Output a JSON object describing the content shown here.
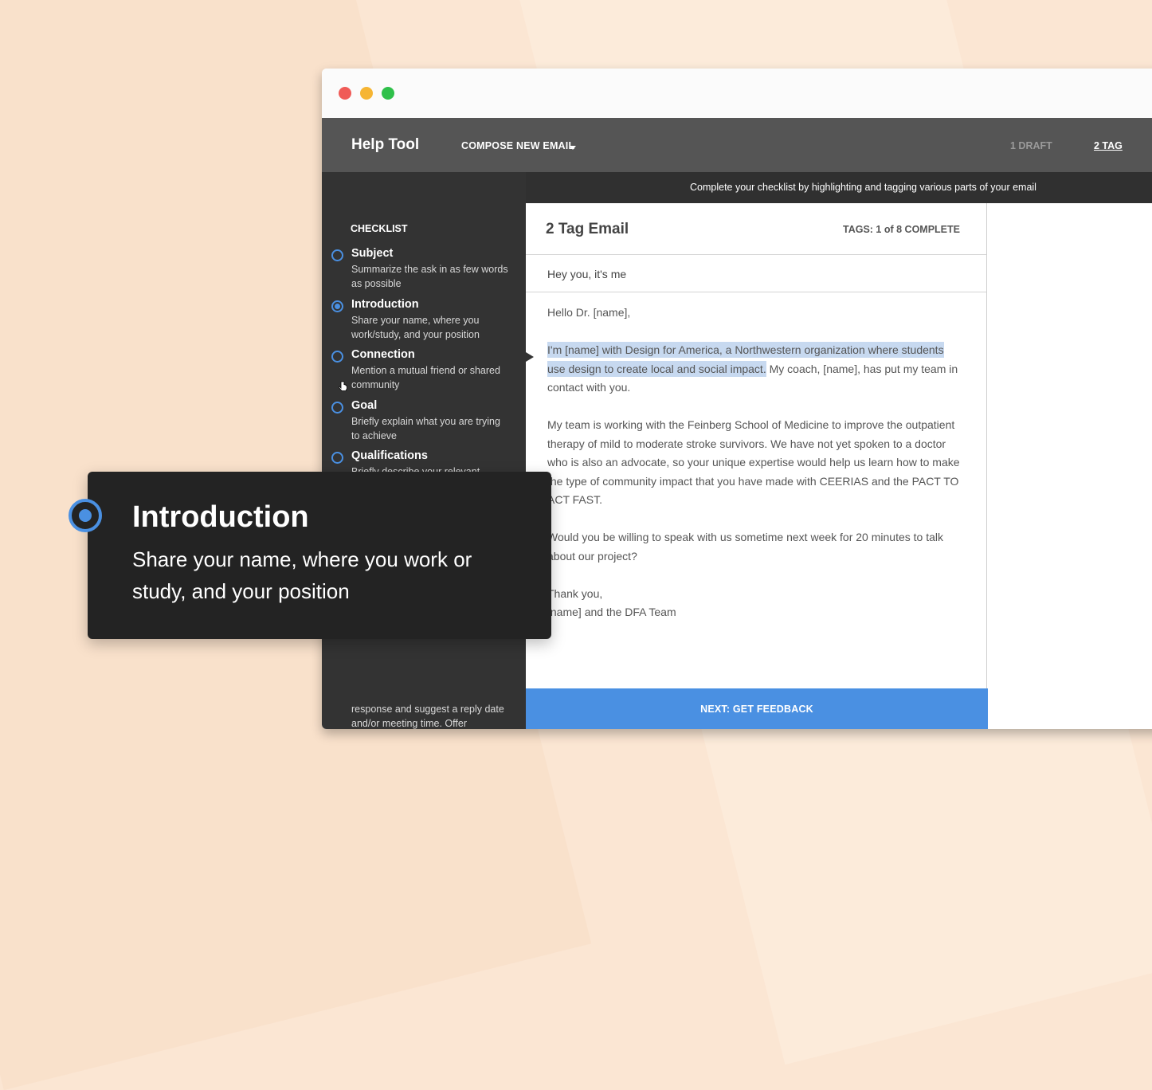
{
  "app": {
    "title": "Help Tool",
    "compose_label": "COMPOSE NEW EMAIL",
    "nav_draft": "1 DRAFT",
    "nav_tag": "2 TAG",
    "instruction": "Complete your checklist by highlighting and tagging various parts of your email"
  },
  "sidebar": {
    "heading": "CHECKLIST",
    "items": [
      {
        "title": "Subject",
        "desc": "Summarize the ask in as few words as possible",
        "state": "empty"
      },
      {
        "title": "Introduction",
        "desc": "Share your name, where you work/study, and your position",
        "state": "selected"
      },
      {
        "title": "Connection",
        "desc": "Mention a mutual friend or shared community",
        "state": "empty"
      },
      {
        "title": "Goal",
        "desc": "Briefly explain what you are trying to achieve",
        "state": "empty"
      },
      {
        "title": "Qualifications",
        "desc": "Briefly describe your relevant",
        "state": "empty"
      }
    ],
    "bottom_desc": "response and suggest a reply date and/or meeting time. Offer something in return if possible."
  },
  "editor": {
    "title": "2 Tag Email",
    "tags_status": "TAGS: 1 of 8 COMPLETE",
    "subject": "Hey you, it's me",
    "greeting": "Hello Dr. [name],",
    "para1_highlight": "I'm [name] with Design for America, a Northwestern organization where students use design to create local and social impact.",
    "para1_rest": " My coach, [name], has put my team in contact with you.",
    "para2": "My team is working with the Feinberg School of Medicine to improve the outpatient therapy of mild to moderate stroke survivors. We have not yet spoken to a doctor who is also an advocate, so your unique expertise would help us learn how to make the type of community impact that you have made with CEERIAS and the PACT TO ACT FAST.",
    "para3": "Would you be willing to speak with us sometime next week for 20 minutes to talk about our project?",
    "signoff1": "Thank you,",
    "signoff2": "[name] and the DFA Team",
    "next_button": "NEXT: GET FEEDBACK"
  },
  "card": {
    "title": "Introduction",
    "desc": "Share your name, where you work or study, and your position"
  },
  "colors": {
    "accent": "#4a90e2",
    "background": "#fbe6d3",
    "dark": "#333333"
  },
  "icons": [
    "radio-empty-icon",
    "radio-selected-icon",
    "pointer-cursor-icon",
    "caret-down-icon"
  ]
}
